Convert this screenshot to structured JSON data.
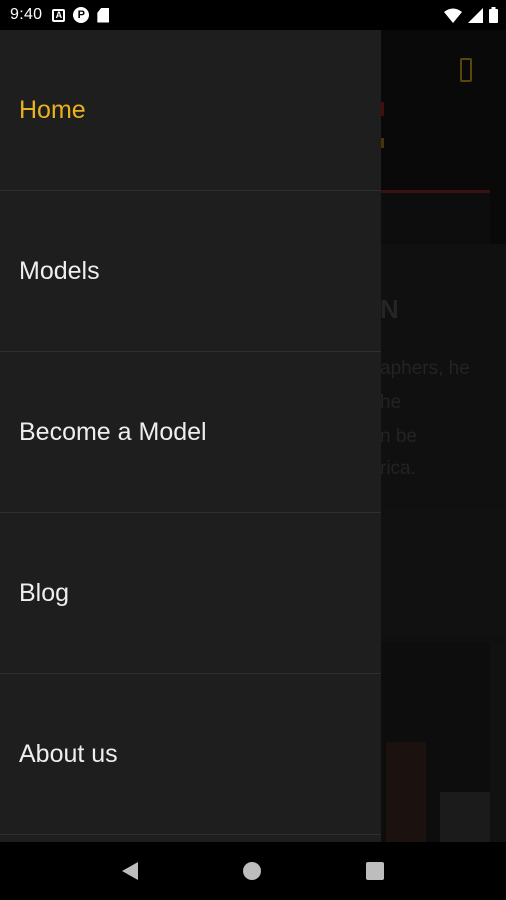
{
  "status_bar": {
    "time": "9:40",
    "notification_icons": [
      "a-box-icon",
      "p-circle-icon",
      "sd-card-icon"
    ],
    "system_icons": [
      "wifi-icon",
      "signal-icon",
      "battery-icon"
    ]
  },
  "background_text": {
    "heading_fragment": "N",
    "lines": [
      "aphers, he",
      "he",
      "n be",
      "rica."
    ]
  },
  "drawer": {
    "items": [
      {
        "label": "Home",
        "active": true
      },
      {
        "label": "Models",
        "active": false
      },
      {
        "label": "Become a Model",
        "active": false
      },
      {
        "label": "Blog",
        "active": false
      },
      {
        "label": "About us",
        "active": false
      }
    ]
  },
  "colors": {
    "accent": "#e8b21e",
    "drawer_bg": "#1e1e1e",
    "divider": "#2f2f2f"
  },
  "nav_bar": {
    "buttons": [
      "back-icon",
      "home-icon",
      "recents-icon"
    ]
  }
}
